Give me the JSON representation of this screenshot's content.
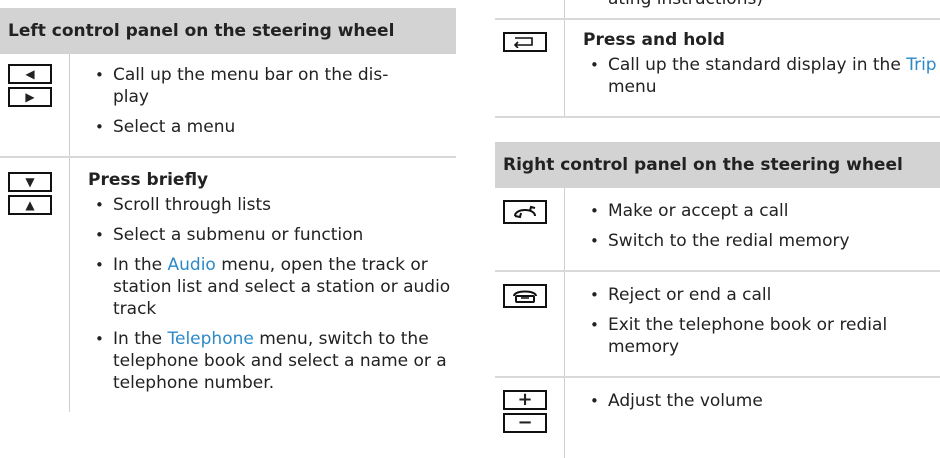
{
  "left": {
    "header": "Left control panel on the steering wheel",
    "rows": [
      {
        "keys": [
          {
            "icon": "left-triangle-icon",
            "glyph": "◀"
          },
          {
            "icon": "right-triangle-icon",
            "glyph": "▶"
          }
        ],
        "items": [
          {
            "text": "Call up the menu bar on the dis-\nplay"
          },
          {
            "text": "Select a menu"
          }
        ]
      },
      {
        "keys": [
          {
            "icon": "down-triangle-icon",
            "glyph": "▼"
          },
          {
            "icon": "up-triangle-icon",
            "glyph": "▲"
          }
        ],
        "heading": "Press briefly",
        "items": [
          {
            "text": "Scroll through lists"
          },
          {
            "text": "Select a submenu or function"
          },
          {
            "pre": "In the ",
            "link": "Audio",
            "post": " menu, open the track or station list and select a station or audio track"
          },
          {
            "pre": "In the ",
            "link": "Telephone",
            "post": " menu, switch to the telephone book and select a name or a telephone number."
          }
        ]
      }
    ]
  },
  "right": {
    "top_fragment": "ating instructions)",
    "back_row": {
      "key_icon": "back-arrow-icon",
      "heading": "Press and hold",
      "item": {
        "pre": "Call up the standard display in the ",
        "link": "Trip",
        "post": " menu"
      }
    },
    "header": "Right control panel on the steering wheel",
    "rows": [
      {
        "key_icon": "phone-accept-icon",
        "items": [
          "Make or accept a call",
          "Switch to the redial memory"
        ]
      },
      {
        "key_icon": "phone-hangup-icon",
        "items": [
          "Reject or end a call",
          "Exit the telephone book or redial memory"
        ]
      },
      {
        "keys": [
          {
            "icon": "plus-icon",
            "glyph": "+"
          },
          {
            "icon": "minus-icon",
            "glyph": "−"
          }
        ],
        "items": [
          "Adjust the volume"
        ]
      }
    ]
  },
  "colors": {
    "link": "#2b8ac7",
    "header_bg": "#d3d3d3"
  }
}
